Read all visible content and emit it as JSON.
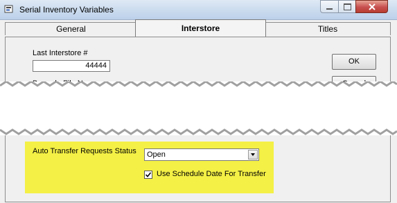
{
  "window": {
    "title": "Serial Inventory Variables"
  },
  "tabs": [
    {
      "label": "General"
    },
    {
      "label": "Interstore",
      "active": true
    },
    {
      "label": "Titles"
    }
  ],
  "form": {
    "last_interstore_label": "Last Interstore #",
    "last_interstore_value": "44444",
    "barcode_label_partial": "Barcode File Name",
    "auto_transfer_label": "Auto Transfer Requests Status",
    "auto_transfer_value": "Open",
    "schedule_checkbox_label": "Use Schedule Date For Transfer",
    "schedule_checked": true
  },
  "buttons": {
    "ok": "OK",
    "cancel_partial": "Cancel"
  },
  "colors": {
    "highlight": "#f4f045",
    "titlebar": "#cadbee",
    "close": "#c75050"
  }
}
